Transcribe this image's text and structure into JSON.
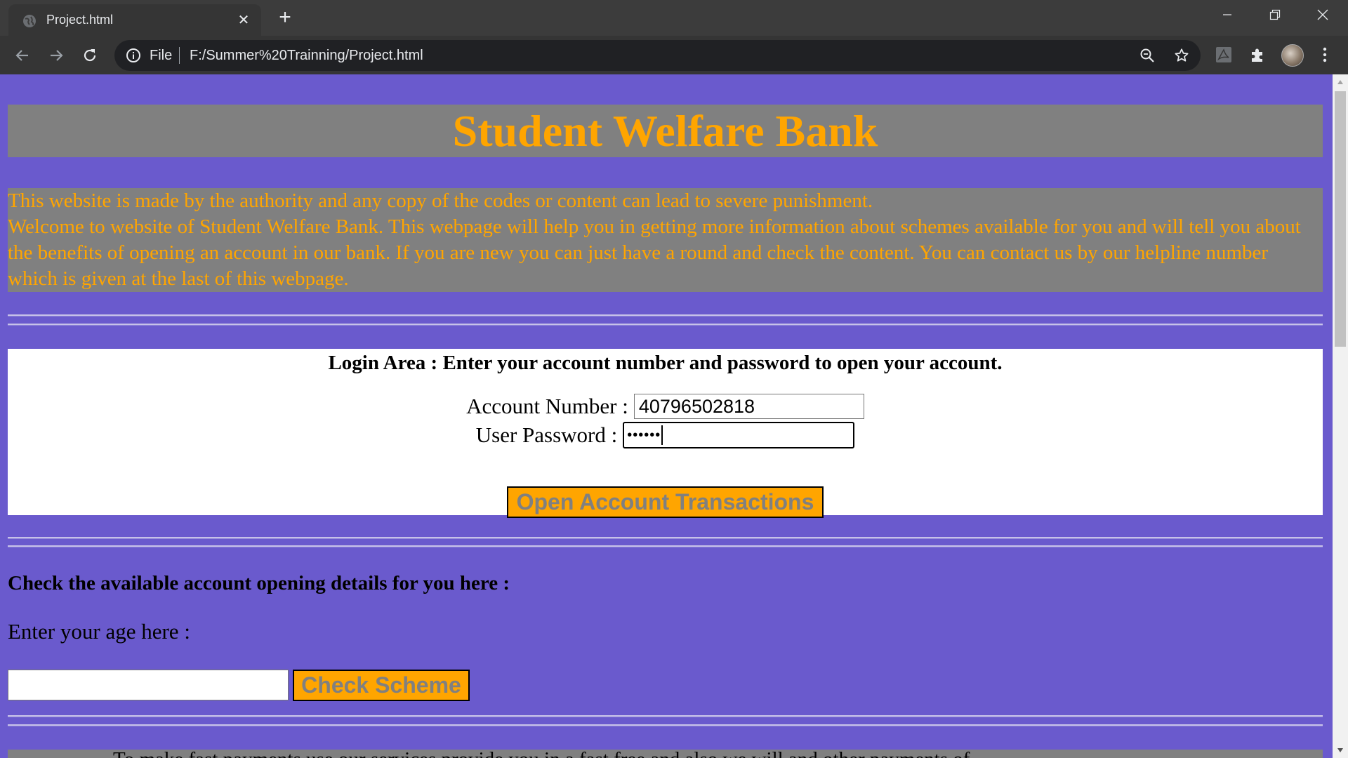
{
  "browser": {
    "tab_title": "Project.html",
    "scheme_label": "File",
    "url": "F:/Summer%20Trainning/Project.html"
  },
  "page": {
    "banner_title": "Student Welfare Bank",
    "intro_line1": "This website is made by the authority and any copy of the codes or content can lead to severe punishment.",
    "intro_line2": "Welcome to website of Student Welfare Bank. This webpage will help you in getting more information about schemes available for you and will tell you about the benefits of opening an account in our bank. If you are new you can just have a round and check the content. You can contact us by our helpline number which is given at the last of this webpage.",
    "login": {
      "heading": "Login Area : Enter your account number and password to open your account.",
      "account_label": "Account Number :",
      "account_value": "40796502818",
      "password_label": "User Password :",
      "password_value": "••••••",
      "open_button": "Open Account Transactions"
    },
    "scheme": {
      "heading": "Check the available account opening details for you here :",
      "age_label": "Enter your age here :",
      "age_value": "",
      "check_button": "Check Scheme"
    },
    "bottom_partial": "To make fast payments use our services provide you in a fast free and also we will and other payments of"
  },
  "colors": {
    "page_bg": "#6a5acd",
    "banner_bg": "#808080",
    "accent_text": "#ffa500"
  }
}
